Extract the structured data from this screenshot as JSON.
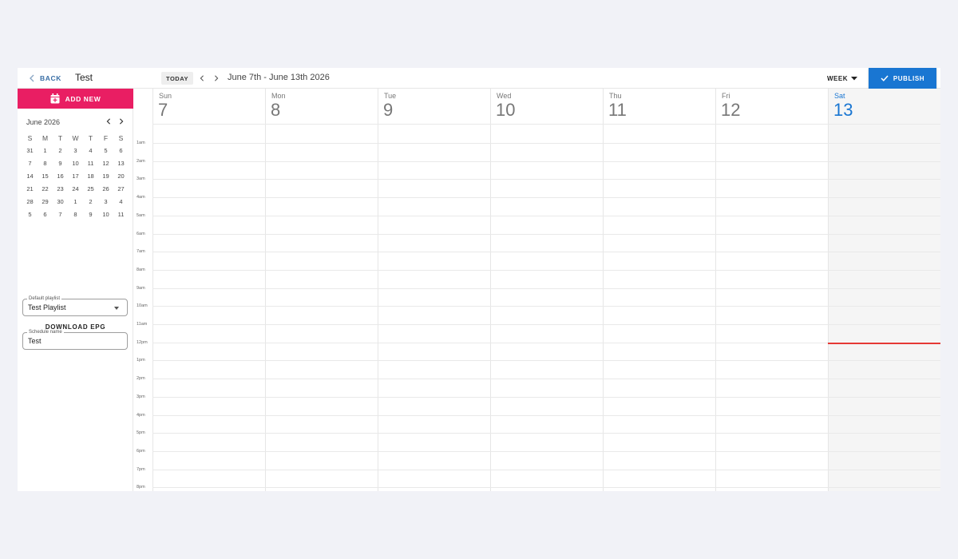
{
  "header": {
    "back_label": "BACK",
    "schedule_title": "Test",
    "today_label": "TODAY",
    "date_range": "June 7th - June 13th 2026",
    "view_label": "WEEK",
    "publish_label": "PUBLISH"
  },
  "sidebar": {
    "add_new_label": "ADD NEW",
    "mini_calendar": {
      "month_label": "June 2026",
      "weekdays": [
        "S",
        "M",
        "T",
        "W",
        "T",
        "F",
        "S"
      ],
      "weeks": [
        [
          "31",
          "1",
          "2",
          "3",
          "4",
          "5",
          "6"
        ],
        [
          "7",
          "8",
          "9",
          "10",
          "11",
          "12",
          "13"
        ],
        [
          "14",
          "15",
          "16",
          "17",
          "18",
          "19",
          "20"
        ],
        [
          "21",
          "22",
          "23",
          "24",
          "25",
          "26",
          "27"
        ],
        [
          "28",
          "29",
          "30",
          "1",
          "2",
          "3",
          "4"
        ],
        [
          "5",
          "6",
          "7",
          "8",
          "9",
          "10",
          "11"
        ]
      ]
    },
    "default_playlist": {
      "label": "Default playlist",
      "value": "Test Playlist"
    },
    "schedule_name": {
      "label": "Schedule name",
      "value": "Test"
    },
    "download_label": "DOWNLOAD EPG"
  },
  "calendar": {
    "days": [
      {
        "name": "Sun",
        "number": "7",
        "today": false
      },
      {
        "name": "Mon",
        "number": "8",
        "today": false
      },
      {
        "name": "Tue",
        "number": "9",
        "today": false
      },
      {
        "name": "Wed",
        "number": "10",
        "today": false
      },
      {
        "name": "Thu",
        "number": "11",
        "today": false
      },
      {
        "name": "Fri",
        "number": "12",
        "today": false
      },
      {
        "name": "Sat",
        "number": "13",
        "today": true
      }
    ],
    "hours": [
      "1am",
      "2am",
      "3am",
      "4am",
      "5am",
      "6am",
      "7am",
      "8am",
      "9am",
      "10am",
      "11am",
      "12pm",
      "1pm",
      "2pm",
      "3pm",
      "4pm",
      "5pm",
      "6pm",
      "7pm",
      "8pm"
    ]
  },
  "colors": {
    "accent_pink": "#e91e63",
    "publish_blue": "#1976d2",
    "current_time_red": "#e53935"
  },
  "icons": {
    "back": "chevron-left-icon",
    "add_new": "calendar-plus-icon",
    "publish": "check-icon",
    "view_dropdown": "caret-down-icon"
  }
}
